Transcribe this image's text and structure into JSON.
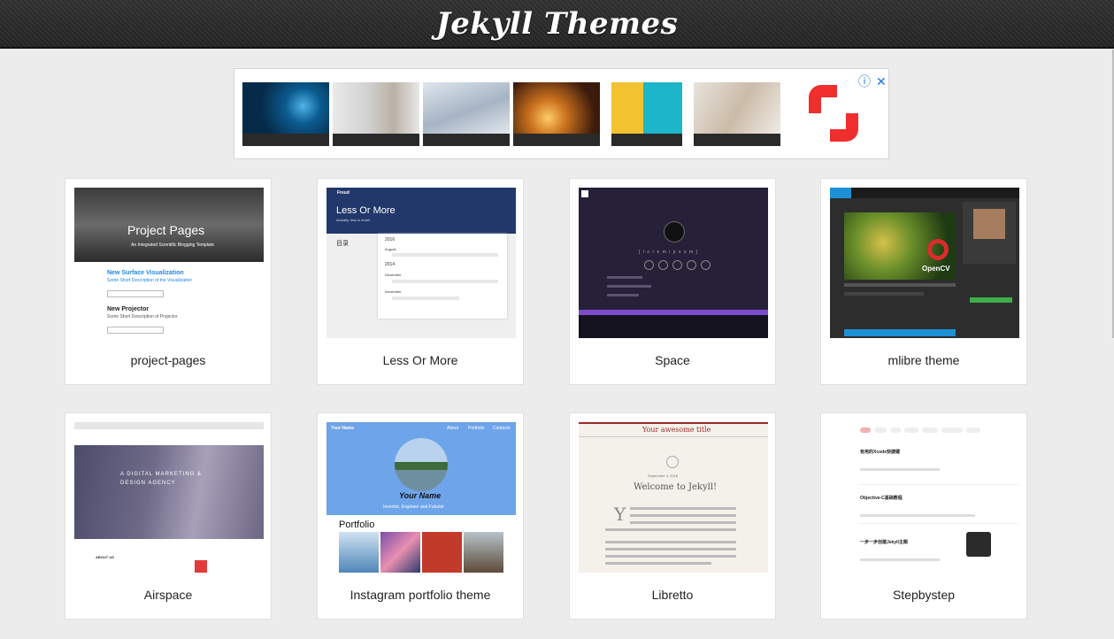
{
  "header": {
    "title": "Jekyll Themes"
  },
  "ad": {
    "close_icon": "close-icon",
    "info_icon": "info-icon"
  },
  "themes": [
    {
      "name": "project-pages"
    },
    {
      "name": "Less Or More"
    },
    {
      "name": "Space"
    },
    {
      "name": "mlibre theme"
    },
    {
      "name": "Airspace"
    },
    {
      "name": "Instagram portfolio theme"
    },
    {
      "name": "Libretto"
    },
    {
      "name": "Stepbystep"
    }
  ],
  "previews": {
    "project_pages": {
      "hero_title": "Project Pages",
      "hero_sub": "An Integrated Scientific Blogging Template",
      "post1_title": "New Surface Visualization",
      "post1_sub": "Some Short Description of the Visualization",
      "post2_title": "New Projector",
      "post2_sub": "Some Short Description of Projector"
    },
    "less_or_more": {
      "brand": "Freud",
      "title": "Less Or More",
      "tagline": "Actually, less is more!",
      "toc": "目录",
      "year1": "2016",
      "month1": "August",
      "year2": "2014",
      "month2": "December",
      "month3": "November"
    },
    "space": {
      "label": "[ l o r e m   i p s u m ]"
    },
    "mlibre": {
      "opencv": "OpenCV"
    },
    "airspace": {
      "headline1": "A DIGITAL MARKETING &",
      "headline2": "DESIGN AGENCY",
      "about": "ABOUT US"
    },
    "instagram": {
      "brand": "Your Name",
      "nav1": "About",
      "nav2": "Portfolio",
      "nav3": "Contacts",
      "name": "Your Name",
      "tagline": "Inventor, Engineer and Futurist",
      "section": "Portfolio"
    },
    "libretto": {
      "site_title": "Your awesome title",
      "post_title": "Welcome to Jekyll!",
      "date": "September 4, 2016"
    },
    "stepbystep": {
      "post1": "有用的Xcode快捷键",
      "post2": "Objective-C基础教程",
      "post3": "一步一步创建Jekyll主题"
    }
  },
  "colors": {
    "header_bg": "#2a2a2a",
    "page_bg": "#ececec",
    "card_bg": "#ffffff"
  }
}
